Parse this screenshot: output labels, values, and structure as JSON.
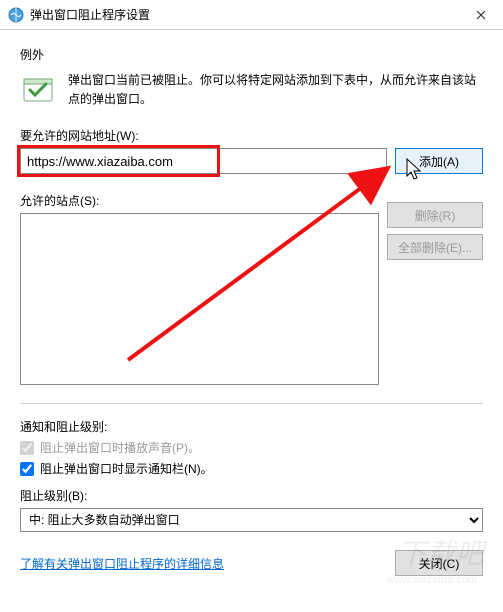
{
  "titlebar": {
    "title": "弹出窗口阻止程序设置"
  },
  "exception": {
    "heading": "例外",
    "text": "弹出窗口当前已被阻止。你可以将特定网站添加到下表中，从而允许来自该站点的弹出窗口。"
  },
  "url_field": {
    "label": "要允许的网站地址(W):",
    "value": "https://www.xiazaiba.com"
  },
  "buttons": {
    "add": "添加(A)",
    "remove": "删除(R)",
    "remove_all": "全部删除(E)...",
    "close": "关闭(C)"
  },
  "allowed": {
    "label": "允许的站点(S):"
  },
  "notify": {
    "heading": "通知和阻止级别:",
    "sound": "阻止弹出窗口时播放声音(P)。",
    "bar": "阻止弹出窗口时显示通知栏(N)。"
  },
  "level": {
    "label": "阻止级别(B):",
    "selected": "中: 阻止大多数自动弹出窗口"
  },
  "link": {
    "text": "了解有关弹出窗口阻止程序的详细信息"
  },
  "watermark": {
    "main": "下载吧",
    "sub": "www.xiazaiba.com"
  }
}
